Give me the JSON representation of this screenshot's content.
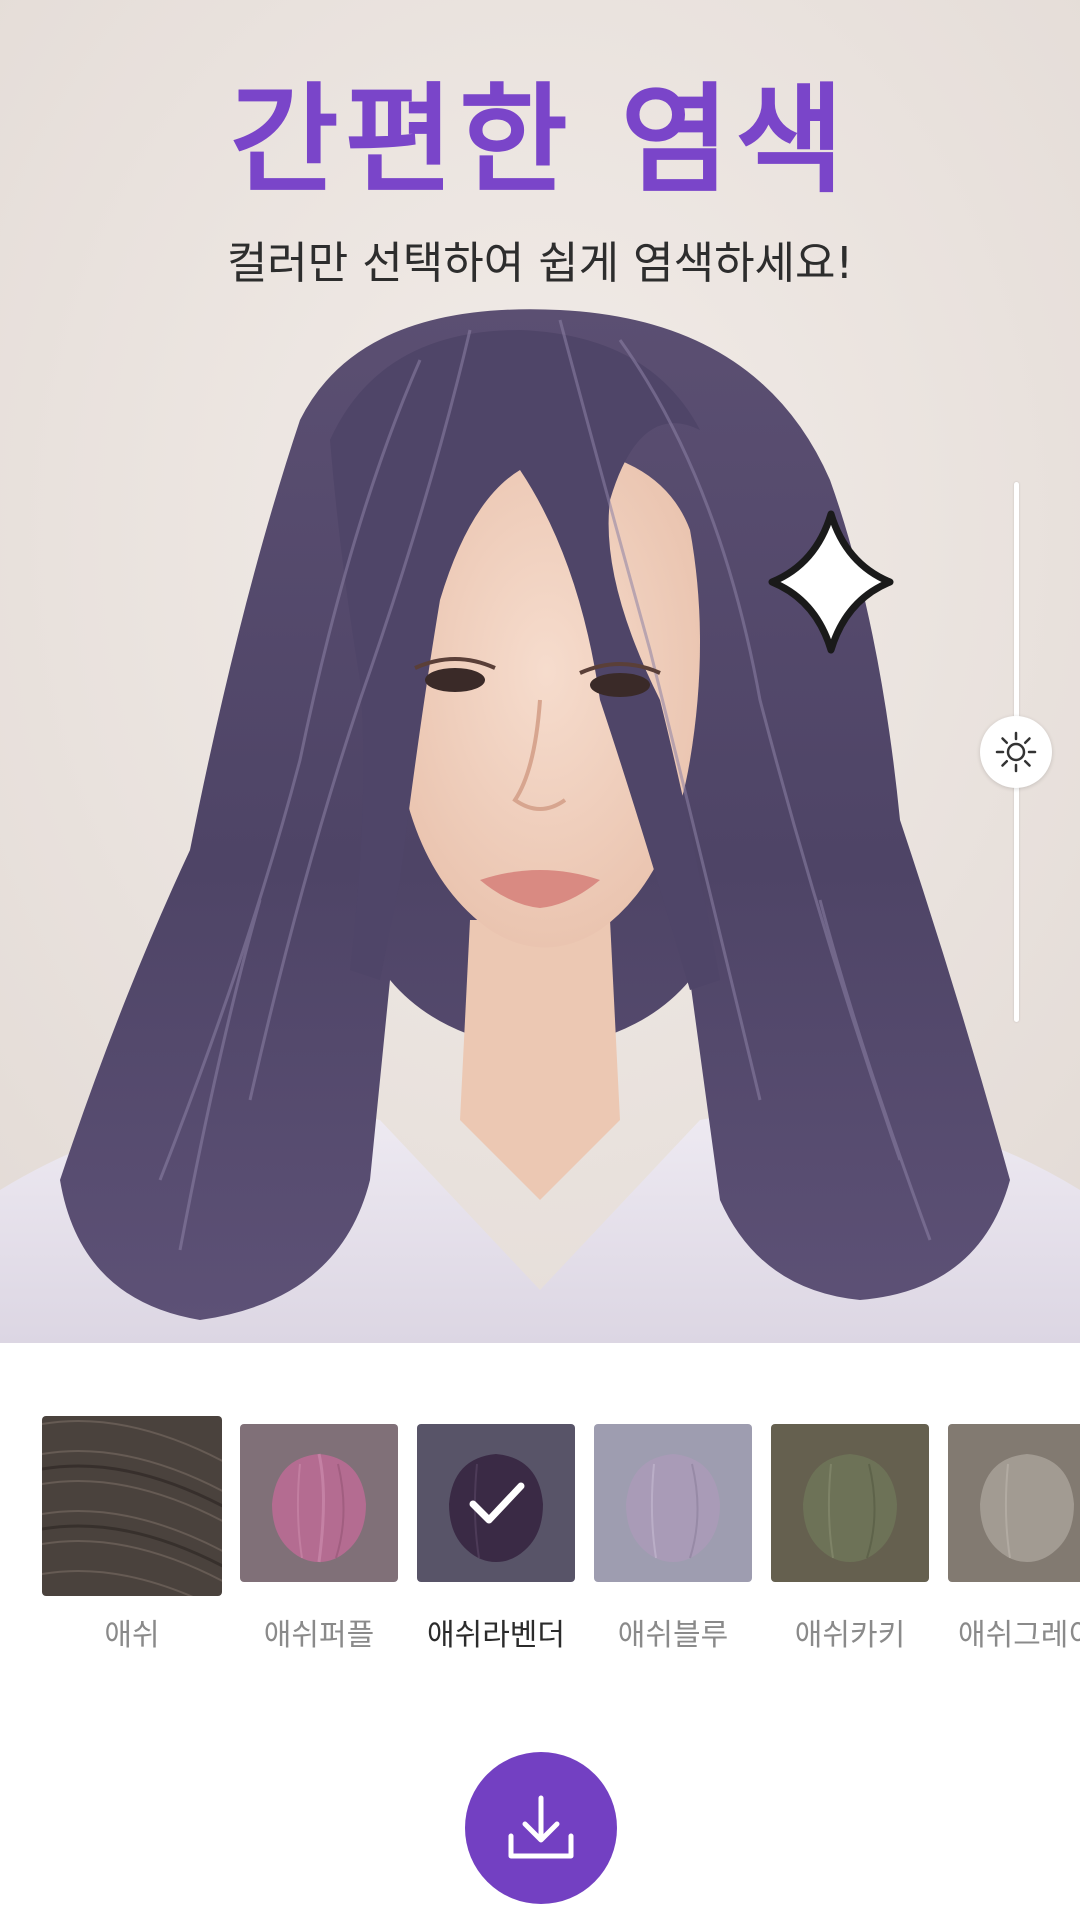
{
  "header": {
    "title": "간편한 염색",
    "subtitle": "컬러만 선택하여 쉽게 염색하세요!"
  },
  "colors": {
    "accent": "#7340c2",
    "title": "#7a45c9",
    "selected_hair_tint": "#594e70"
  },
  "brightness_slider": {
    "icon": "sun-icon",
    "level": 0.5
  },
  "sticker": {
    "icon": "sparkle-icon"
  },
  "color_picker": {
    "selected_index": 2,
    "items": [
      {
        "label": "애쉬",
        "background": "#4a423d",
        "swatch": "#4a423d"
      },
      {
        "label": "애쉬퍼플",
        "background": "#807078",
        "swatch": "#b46c91"
      },
      {
        "label": "애쉬라벤더",
        "background": "#585468",
        "swatch": "#3a2a45"
      },
      {
        "label": "애쉬블루",
        "background": "#9e9db0",
        "swatch": "#a99bb7"
      },
      {
        "label": "애쉬카키",
        "background": "#65604f",
        "swatch": "#6d7257"
      },
      {
        "label": "애쉬그레이",
        "background": "#827a71",
        "swatch": "#a29b92"
      }
    ]
  },
  "actions": {
    "download_icon": "download-icon"
  }
}
